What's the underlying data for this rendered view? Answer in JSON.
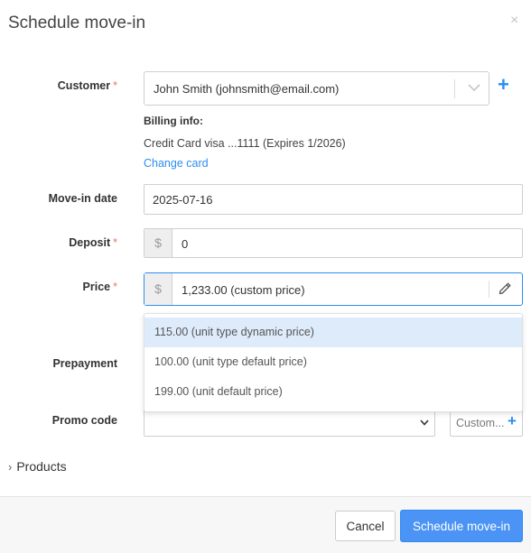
{
  "modal": {
    "title": "Schedule move-in",
    "close_glyph": "×"
  },
  "customer": {
    "label": "Customer",
    "required_mark": "*",
    "value": "John Smith (johnsmith@email.com)",
    "add_glyph": "+",
    "billing_heading": "Billing info:",
    "billing_text": "Credit Card visa ...1111 (Expires 1/2026)",
    "change_card": "Change card"
  },
  "move_in_date": {
    "label": "Move-in date",
    "value": "2025-07-16"
  },
  "deposit": {
    "label": "Deposit",
    "required_mark": "*",
    "currency": "$",
    "value": "0"
  },
  "price": {
    "label": "Price",
    "required_mark": "*",
    "currency": "$",
    "value": "1,233.00 (custom price)",
    "options": [
      {
        "label": "115.00 (unit type dynamic price)",
        "highlighted": true
      },
      {
        "label": "100.00 (unit type default price)",
        "highlighted": false
      },
      {
        "label": "199.00 (unit default price)",
        "highlighted": false
      }
    ]
  },
  "prepayment": {
    "label": "Prepayment"
  },
  "promo_code": {
    "label": "Promo code",
    "value": "",
    "custom_label": "Custom...",
    "custom_plus": "+"
  },
  "products": {
    "arrow": "›",
    "label": "Products"
  },
  "footer": {
    "cancel": "Cancel",
    "submit": "Schedule move-in"
  },
  "colors": {
    "accent": "#2d8cf0",
    "primary_button": "#4b94f5",
    "required": "#e8746b",
    "option_highlight": "#deebfb"
  }
}
